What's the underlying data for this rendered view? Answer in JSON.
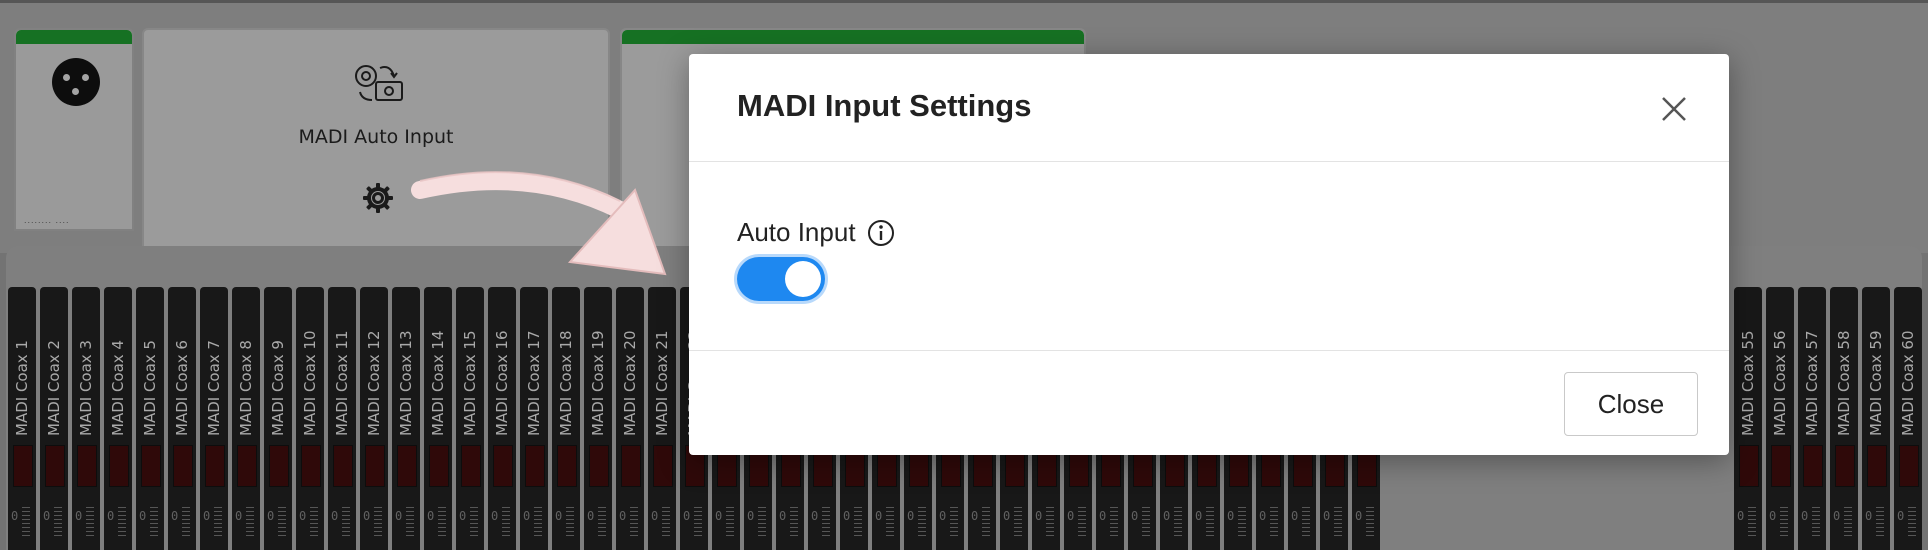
{
  "background": {
    "auto_card": {
      "label": "MADI Auto Input",
      "icon": "auto-input-icon",
      "settings_icon": "gear-icon"
    },
    "xlr_card": {
      "icon": "xlr-connector-icon",
      "footer_dots": "........ ...."
    },
    "accent_green": "#1c8a2b"
  },
  "channels": {
    "prefix": "MADI Coax",
    "left_numbers": [
      1,
      2,
      3,
      4,
      5,
      6,
      7,
      8,
      9,
      10,
      11,
      12,
      13,
      14,
      15,
      16,
      17,
      18,
      19,
      20,
      21
    ],
    "right_numbers": [
      55,
      56,
      57,
      58,
      59,
      60
    ],
    "level_label": "0"
  },
  "modal": {
    "title": "MADI Input Settings",
    "field_label": "Auto Input",
    "toggle_on": true,
    "close_button_label": "Close",
    "accent": "#1e88f0"
  }
}
